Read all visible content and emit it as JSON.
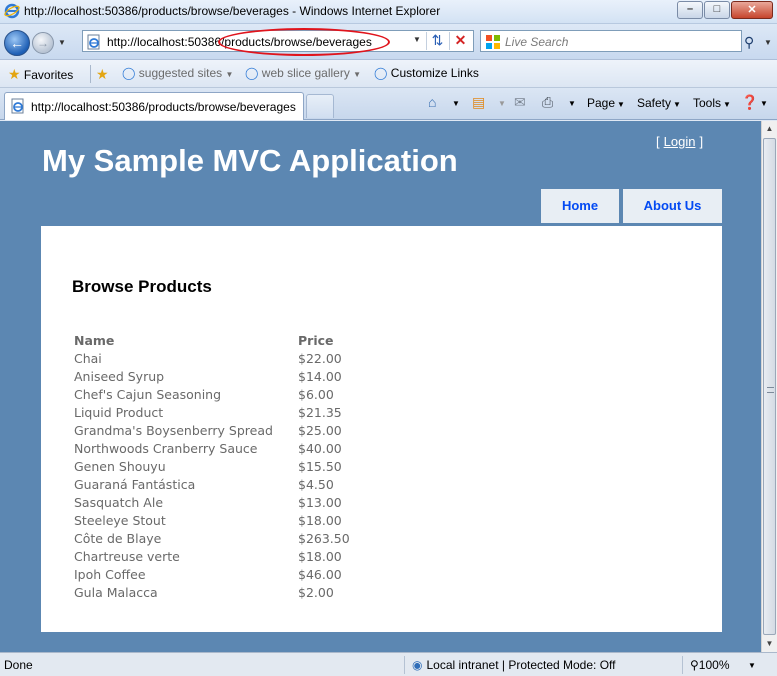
{
  "window": {
    "title": "http://localhost:50386/products/browse/beverages - Windows Internet Explorer",
    "minimize": "–",
    "maximize": "□",
    "close": "✕"
  },
  "address_bar": {
    "url": "http://localhost:50386/products/browse/beverages",
    "search_placeholder": "Live Search"
  },
  "favorites_bar": {
    "favorites_label": "Favorites",
    "items": [
      {
        "label": "suggested sites"
      },
      {
        "label": "web slice gallery"
      },
      {
        "label": "Customize Links"
      }
    ]
  },
  "tab": {
    "label": "http://localhost:50386/products/browse/beverages"
  },
  "command_bar": {
    "page_label": "Page",
    "safety_label": "Safety",
    "tools_label": "Tools"
  },
  "page": {
    "app_title": "My Sample MVC Application",
    "login_open": "[",
    "login_label": "Login",
    "login_close": "]",
    "menu": [
      {
        "label": "Home"
      },
      {
        "label": "About Us"
      }
    ],
    "heading": "Browse Products",
    "table": {
      "columns": [
        "Name",
        "Price"
      ],
      "rows": [
        {
          "name": "Chai",
          "price": "$22.00"
        },
        {
          "name": "Aniseed Syrup",
          "price": "$14.00"
        },
        {
          "name": "Chef's Cajun Seasoning",
          "price": "$6.00"
        },
        {
          "name": "Liquid Product",
          "price": "$21.35"
        },
        {
          "name": "Grandma's Boysenberry Spread",
          "price": "$25.00"
        },
        {
          "name": "Northwoods Cranberry Sauce",
          "price": "$40.00"
        },
        {
          "name": "Genen Shouyu",
          "price": "$15.50"
        },
        {
          "name": "Guaraná Fantástica",
          "price": "$4.50"
        },
        {
          "name": "Sasquatch Ale",
          "price": "$13.00"
        },
        {
          "name": "Steeleye Stout",
          "price": "$18.00"
        },
        {
          "name": "Côte de Blaye",
          "price": "$263.50"
        },
        {
          "name": "Chartreuse verte",
          "price": "$18.00"
        },
        {
          "name": "Ipoh Coffee",
          "price": "$46.00"
        },
        {
          "name": "Gula Malacca",
          "price": "$2.00"
        }
      ]
    }
  },
  "status_bar": {
    "status": "Done",
    "zone": "Local intranet | Protected Mode: Off",
    "zoom": "100%"
  },
  "colors": {
    "page_background": "#5c87b2",
    "menu_text": "#034af3",
    "highlight_ellipse": "#e0141c"
  }
}
